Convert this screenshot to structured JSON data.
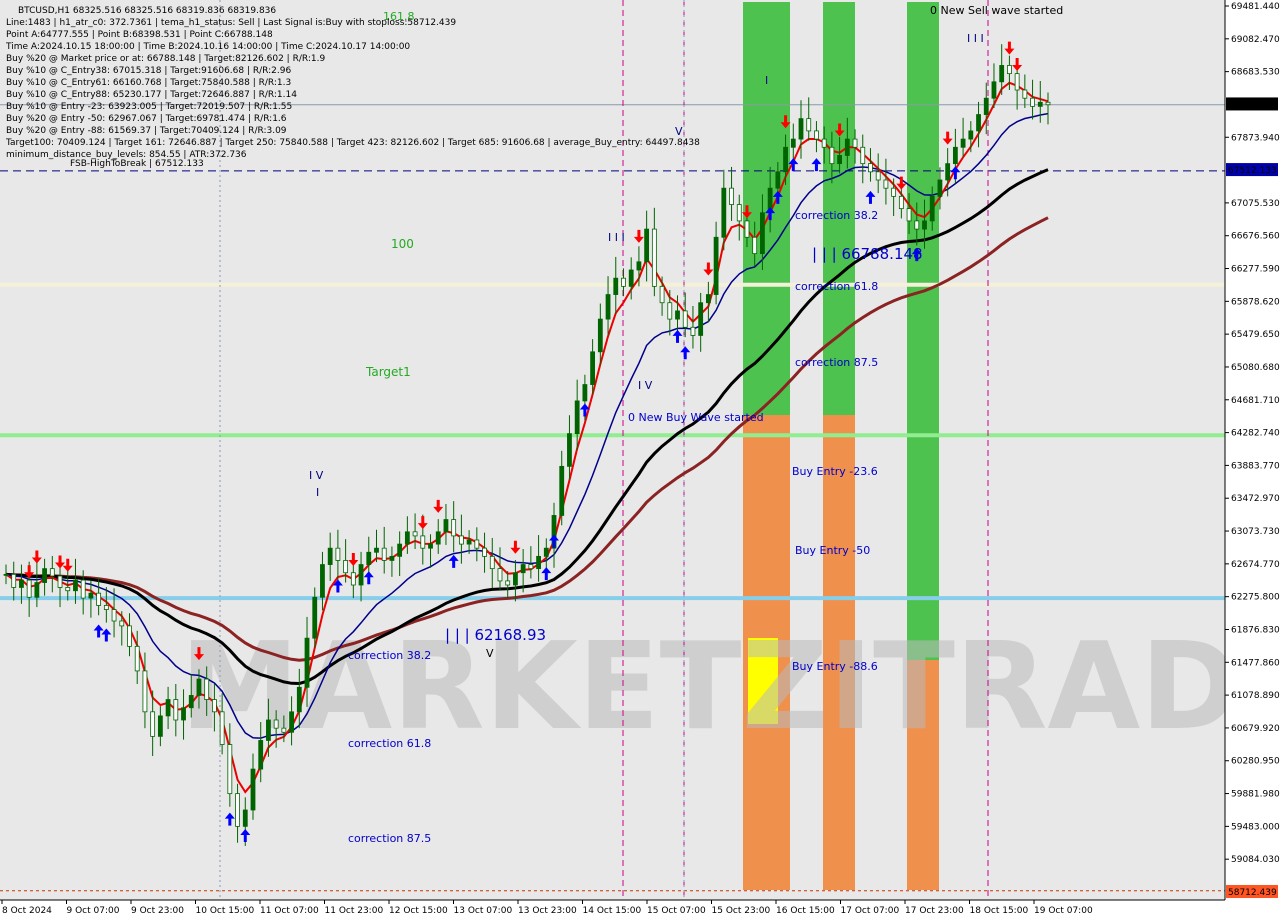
{
  "chart_data": {
    "type": "candlestick",
    "symbol_line": "BTCUSD,H1  68325.516 68325.516 68319.836 68319.836",
    "info_lines": [
      "Line:1483  |  h1_atr_c0: 372.7361  |  tema_h1_status: Sell  |  Last Signal is:Buy with stoploss:58712.439",
      "Point A:64777.555  |  Point B:68398.531  |  Point C:66788.148",
      "Time A:2024.10.15 18:00:00  |  Time B:2024.10.16 14:00:00  |  Time C:2024.10.17 14:00:00",
      "Buy %20 @ Market price or at: 66788.148  |  Target:82126.602  |  R/R:1.9",
      "Buy %10 @ C_Entry38: 67015.318  |  Target:91606.68  |  R/R:2.96",
      "Buy %10 @ C_Entry61: 66160.768  |  Target:75840.588  |  R/R:1.3",
      "Buy %10 @ C_Entry88: 65230.177  |  Target:72646.887  |  R/R:1.14",
      "Buy %10 @ Entry -23: 63923.005  |  Target:72019.507  |  R/R:1.55",
      "Buy %20 @ Entry -50: 62967.067  |  Target:69781.474  |  R/R:1.6",
      "Buy %20 @ Entry -88: 61569.37  |  Target:70409.124  |  R/R:3.09",
      "Target100: 70409.124  |  Target 161: 72646.887  |  Target 250: 75840.588  |  Target 423: 82126.602  |  Target 685: 91606.68  |  average_Buy_entry: 64497.8438",
      "minimum_distance_buy_levels: 854.55  |  ATR:372.736"
    ],
    "y_ticks": [
      "69481.440",
      "69082.470",
      "68683.530",
      "68319.836",
      "67873.940",
      "67512.133",
      "67075.530",
      "66676.560",
      "66277.590",
      "65878.620",
      "65479.650",
      "65080.680",
      "64681.710",
      "64282.740",
      "63883.770",
      "63472.970",
      "63073.730",
      "62674.770",
      "62275.800",
      "61876.830",
      "61477.860",
      "61078.890",
      "60679.920",
      "60280.950",
      "59881.980",
      "59483.000",
      "59084.030",
      "58712.439"
    ],
    "x_ticks": [
      "8 Oct 2024",
      "9 Oct 07:00",
      "9 Oct 23:00",
      "10 Oct 15:00",
      "11 Oct 07:00",
      "11 Oct 23:00",
      "12 Oct 15:00",
      "13 Oct 07:00",
      "13 Oct 23:00",
      "14 Oct 15:00",
      "15 Oct 07:00",
      "15 Oct 23:00",
      "16 Oct 15:00",
      "17 Oct 07:00",
      "17 Oct 23:00",
      "18 Oct 15:00",
      "19 Oct 07:00"
    ],
    "ylim": [
      58600,
      69600
    ],
    "current_price": 68319.836,
    "stoploss": 58712.439,
    "fsb_label": "FSB-HighToBreak | 67512.133",
    "fsb_level": 67512.133,
    "levels": [
      {
        "label": "100",
        "value": 66120,
        "color": "#f5f0d8"
      },
      {
        "label": "Target1",
        "value": 64280,
        "color": "#90ee90"
      },
      {
        "label": "",
        "value": 62290,
        "color": "#87ceeb"
      }
    ],
    "annotations": [
      {
        "text": "161.8"
      },
      {
        "text": "0 New Sell wave started"
      },
      {
        "text": "0 New Buy Wave started"
      },
      {
        "text": "| | | 66788.148"
      },
      {
        "text": "| | | 62168.93"
      },
      {
        "text": "correction 38.2"
      },
      {
        "text": "correction 61.8"
      },
      {
        "text": "correction 87.5"
      },
      {
        "text": "correction 38.2"
      },
      {
        "text": "correction 61.8"
      },
      {
        "text": "correction 87.5"
      },
      {
        "text": "Buy Entry -23.6"
      },
      {
        "text": "Buy Entry -50"
      },
      {
        "text": "Buy Entry -88.6"
      },
      {
        "text": "I V"
      },
      {
        "text": "I V"
      },
      {
        "text": "I"
      },
      {
        "text": "I"
      },
      {
        "text": "V"
      },
      {
        "text": "V"
      },
      {
        "text": "I I I"
      },
      {
        "text": "I I I"
      }
    ],
    "watermark": "MARKETZITRADE",
    "colors": {
      "ema_red": "#ee0000",
      "ema_navy": "#00008b",
      "ema_black": "#000000",
      "ema_brown": "#8b2323",
      "candle": "#006400",
      "bg": "#e8e8e8",
      "zone_green": "#33bb33",
      "zone_orange": "#f08030",
      "zone_yellow": "#ffff00",
      "buy_arrow": "#0000ff",
      "sell_arrow": "#ff0000"
    },
    "candles_close": [
      62580,
      62420,
      62510,
      62300,
      62480,
      62650,
      62560,
      62420,
      62380,
      62510,
      62290,
      62350,
      62200,
      62150,
      62010,
      61950,
      61700,
      61400,
      60900,
      60600,
      60850,
      61050,
      60800,
      60950,
      61100,
      61300,
      61050,
      60900,
      60500,
      59900,
      59500,
      59700,
      60200,
      60550,
      60800,
      60700,
      60650,
      60900,
      61200,
      61800,
      62300,
      62700,
      62900,
      62750,
      62600,
      62450,
      62700,
      62850,
      62900,
      62750,
      62800,
      62950,
      63100,
      63050,
      62900,
      62950,
      63100,
      63250,
      63050,
      62950,
      63000,
      62900,
      62800,
      62650,
      62500,
      62450,
      62600,
      62700,
      62650,
      62800,
      62900,
      63300,
      63900,
      64300,
      64700,
      64900,
      65300,
      65700,
      66000,
      66200,
      66100,
      66300,
      66400,
      66800,
      66100,
      65900,
      65700,
      65800,
      65600,
      65500,
      65900,
      66000,
      66700,
      67300,
      67100,
      66900,
      66700,
      66500,
      67000,
      67300,
      67500,
      67800,
      67900,
      68150,
      68000,
      67900,
      67800,
      67600,
      67700,
      67900,
      67800,
      67600,
      67500,
      67400,
      67300,
      67200,
      67050,
      66900,
      66800,
      66900,
      67200,
      67400,
      67600,
      67800,
      67900,
      68000,
      68200,
      68400,
      68600,
      68800,
      68700,
      68500,
      68400,
      68300,
      68350,
      68320
    ]
  }
}
